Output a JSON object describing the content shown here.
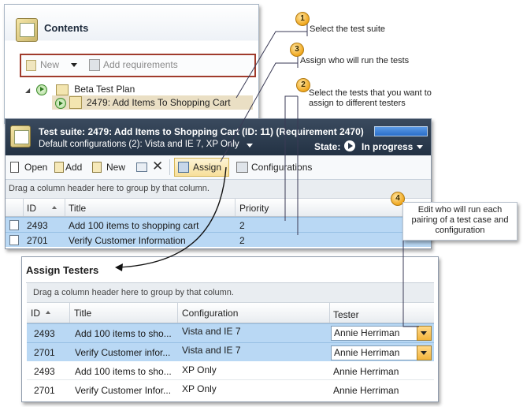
{
  "contents": {
    "title": "Contents",
    "toolbar": {
      "new_label": "New",
      "add_requirements_label": "Add requirements"
    },
    "tree": [
      {
        "label": "Beta Test Plan"
      },
      {
        "label": "2479: Add Items To Shopping Cart"
      }
    ]
  },
  "suite": {
    "title": "Test suite:  2479: Add Items to Shopping Cart (ID: 11) (Requirement 2470)",
    "configs": "Default configurations (2): Vista and IE 7, XP Only",
    "state_label": "State:",
    "state_value": "In progress",
    "toolbar": {
      "open": "Open",
      "add": "Add",
      "new": "New",
      "assign": "Assign",
      "configurations": "Configurations"
    },
    "group_hint": "Drag a column header here to group by that column.",
    "columns": [
      "ID",
      "Title",
      "Priority"
    ],
    "rows": [
      {
        "id": "2493",
        "title": "Add 100 items to shopping cart",
        "priority": "2"
      },
      {
        "id": "2701",
        "title": "Verify Customer Information",
        "priority": "2"
      }
    ]
  },
  "assign": {
    "title": "Assign Testers",
    "group_hint": "Drag a column header here to group by that column.",
    "columns": [
      "ID",
      "Title",
      "Configuration",
      "Tester"
    ],
    "rows": [
      {
        "id": "2493",
        "title": "Add 100 items to sho...",
        "config": "Vista and IE 7",
        "tester": "Annie Herriman"
      },
      {
        "id": "2701",
        "title": "Verify Customer infor...",
        "config": "Vista and IE 7",
        "tester": "Annie Herriman"
      },
      {
        "id": "2493",
        "title": "Add 100 items to sho...",
        "config": "XP Only",
        "tester": "Annie Herriman"
      },
      {
        "id": "2701",
        "title": "Verify Customer Infor...",
        "config": "XP Only",
        "tester": "Annie Herriman"
      }
    ]
  },
  "callouts": [
    {
      "num": "1",
      "text": "Select the test suite"
    },
    {
      "num": "2",
      "text_line1": "Select the tests that you want to",
      "text_line2": "assign to different testers"
    },
    {
      "num": "3",
      "text": "Assign who will run the tests"
    },
    {
      "num": "4",
      "text_line1": "Edit who will run each",
      "text_line2": "pairing of a test case and",
      "text_line3": "configuration"
    }
  ],
  "colors": {
    "selection": "#b9d8f4",
    "header_dark": "#2a394c",
    "callout_orange": "#f0a71d",
    "highlight_border": "#a03b2c"
  }
}
